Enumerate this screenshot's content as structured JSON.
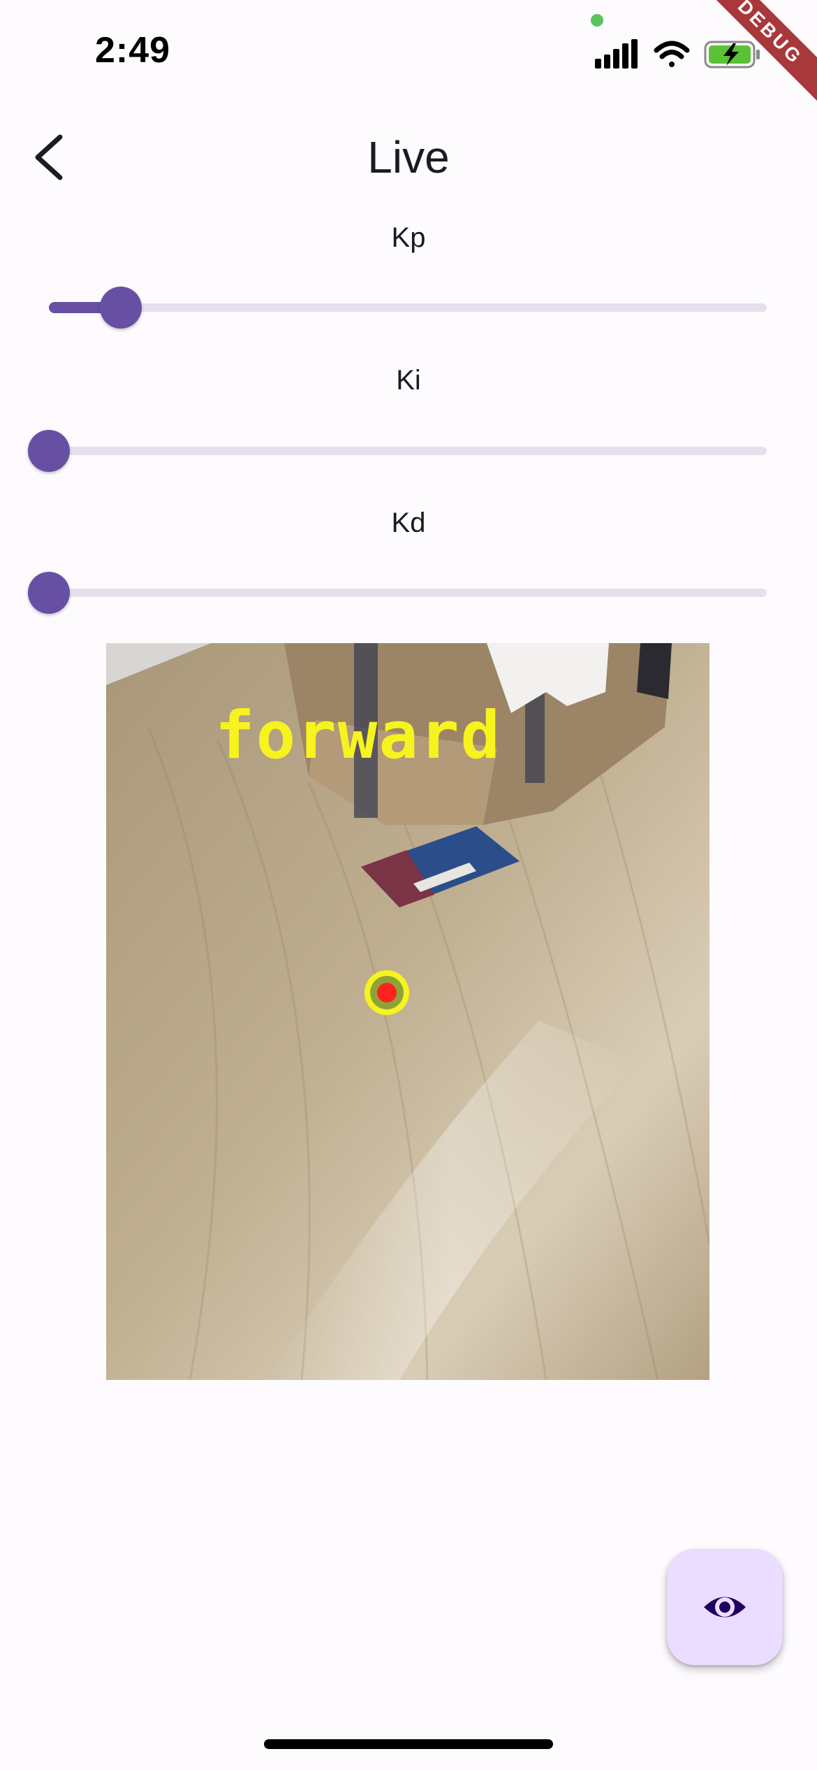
{
  "status_bar": {
    "time": "2:49",
    "icons": [
      "cellular-signal-icon",
      "wifi-icon",
      "battery-charging-icon"
    ],
    "privacy_dot_color": "#5ac35d"
  },
  "debug_banner": "DEBUG",
  "app_bar": {
    "title": "Live",
    "back_icon": "back-arrow-icon"
  },
  "sliders": [
    {
      "label": "Kp",
      "value": 0.1
    },
    {
      "label": "Ki",
      "value": 0.0
    },
    {
      "label": "Kd",
      "value": 0.0
    }
  ],
  "camera": {
    "overlay_text": "forward",
    "overlay_text_color": "#f7f31f",
    "target_marker_color": "#ff2020"
  },
  "fab": {
    "icon": "eye-icon"
  },
  "colors": {
    "accent": "#6750a4",
    "track_inactive": "#e7e0ec",
    "fab_background": "#eaddff",
    "fab_icon": "#21005d",
    "background": "#fdfbfe"
  }
}
